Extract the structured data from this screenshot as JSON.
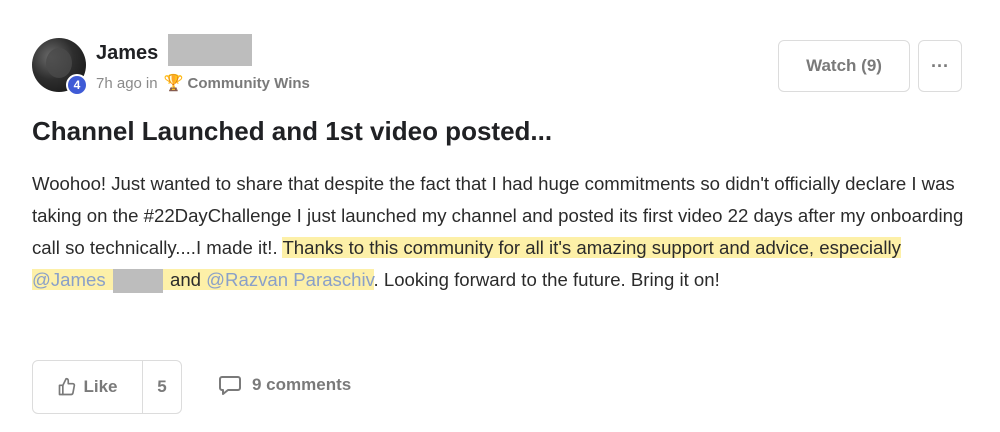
{
  "post": {
    "author": {
      "name": "James",
      "level": "4"
    },
    "time_ago": "7h ago",
    "in_label": "in",
    "category": "Community Wins",
    "title": "Channel Launched and 1st video posted...",
    "body": {
      "part1": "Woohoo! Just wanted to share that despite the fact that I had huge commitments so didn't officially declare I was taking on the #22DayChallenge I just launched my channel and posted its first video 22 days after my onboarding call so technically....I made it!. ",
      "highlight_text": "Thanks to this community for all it's amazing support and advice, especially ",
      "mention1": "@James",
      "between": " and ",
      "mention2": "@Razvan Paraschiv",
      "part2": ". Looking forward to the future. Bring it on!"
    }
  },
  "header_actions": {
    "watch_label": "Watch (9)",
    "more_label": "···"
  },
  "footer": {
    "like_label": "Like",
    "like_count": "5",
    "comments_label": "9 comments"
  },
  "colors": {
    "highlight": "#fdf0a8",
    "mention": "#8aa0c8",
    "level_badge": "#3f5bd6"
  }
}
